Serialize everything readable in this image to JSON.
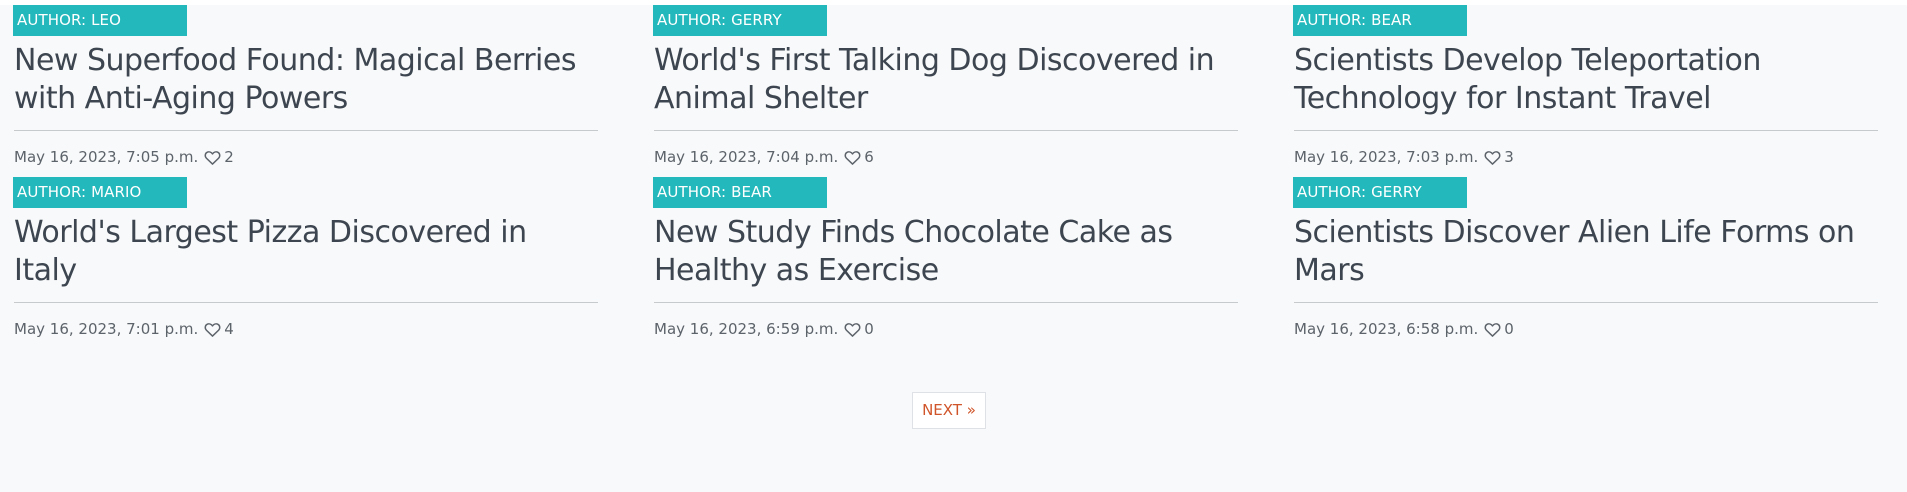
{
  "articles": [
    {
      "author": "AUTHOR: LEO",
      "title": "New Superfood Found: Magical Berries with Anti-Aging Powers",
      "date": "May 16, 2023, 7:05 p.m.",
      "likes": "2"
    },
    {
      "author": "AUTHOR: GERRY",
      "title": "World's First Talking Dog Discovered in Animal Shelter",
      "date": "May 16, 2023, 7:04 p.m.",
      "likes": "6"
    },
    {
      "author": "AUTHOR: BEAR",
      "title": "Scientists Develop Teleportation Technology for Instant Travel",
      "date": "May 16, 2023, 7:03 p.m.",
      "likes": "3"
    },
    {
      "author": "AUTHOR: MARIO",
      "title": "World's Largest Pizza Discovered in Italy",
      "date": "May 16, 2023, 7:01 p.m.",
      "likes": "4"
    },
    {
      "author": "AUTHOR: BEAR",
      "title": "New Study Finds Chocolate Cake as Healthy as Exercise",
      "date": "May 16, 2023, 6:59 p.m.",
      "likes": "0"
    },
    {
      "author": "AUTHOR: GERRY",
      "title": "Scientists Discover Alien Life Forms on Mars",
      "date": "May 16, 2023, 6:58 p.m.",
      "likes": "0"
    }
  ],
  "icons": {
    "like": "heart-outline-icon"
  },
  "pagination": {
    "next_label": "NEXT »"
  },
  "colors": {
    "badge": "#23b8bb",
    "title_text": "#3d4650",
    "meta_text": "#5c636a",
    "next_link": "#d0552a",
    "page_background": "#f8f9fa"
  }
}
